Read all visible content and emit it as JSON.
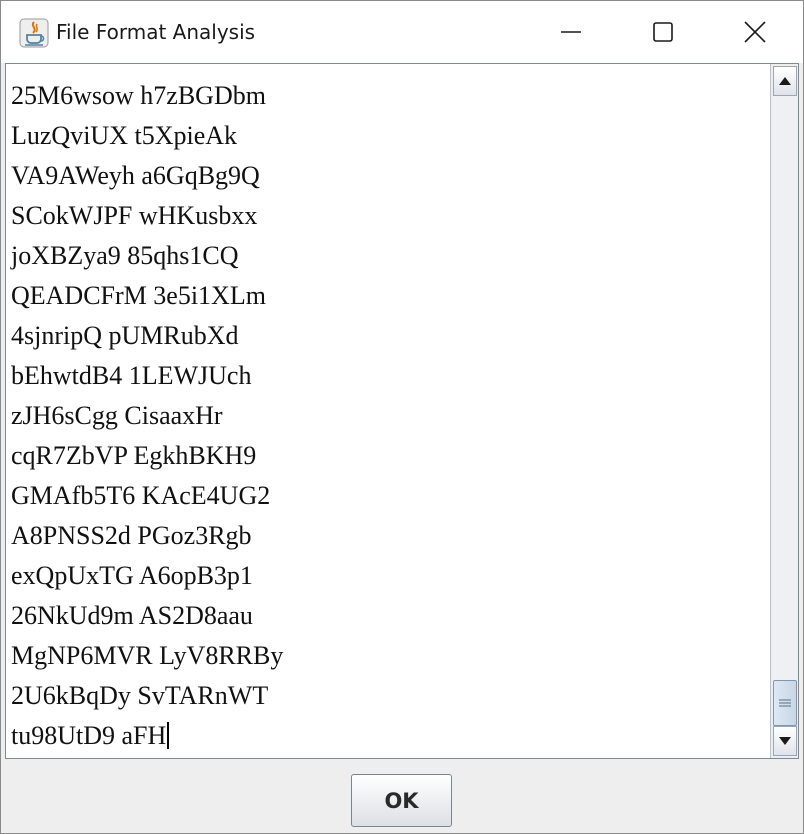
{
  "window": {
    "title": "File Format Analysis",
    "controls": {
      "minimize": "minimize-icon",
      "maximize": "maximize-icon",
      "close": "close-icon"
    }
  },
  "text_area": {
    "lines": [
      "25M6wsow h7zBGDbm",
      "LuzQviUX t5XpieAk",
      "VA9AWeyh a6GqBg9Q",
      "SCokWJPF wHKusbxx",
      "joXBZya9 85qhs1CQ",
      "QEADCFrM 3e5i1XLm",
      "4sjnripQ pUMRubXd",
      "bEhwtdB4 1LEWJUch",
      "zJH6sCgg CisaaxHr",
      "cqR7ZbVP EgkhBKH9",
      "GMAfb5T6 KAcE4UG2",
      "A8PNSS2d PGoz3Rgb",
      "exQpUxTG A6opB3p1",
      "26NkUd9m AS2D8aau",
      "MgNP6MVR LyV8RRBy",
      "2U6kBqDy SvTARnWT",
      "tu98UtD9 aFH"
    ]
  },
  "footer": {
    "ok_label": "OK"
  },
  "colors": {
    "titlebar_bg": "#ffffff",
    "dialog_bg": "#eeeeee",
    "java_icon_orange": "#e76f00",
    "java_icon_blue": "#5382a1"
  }
}
